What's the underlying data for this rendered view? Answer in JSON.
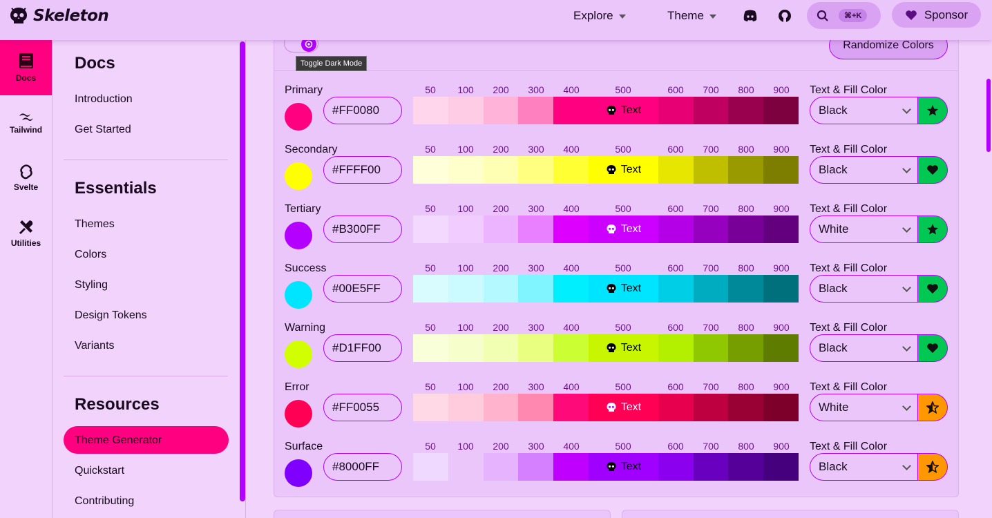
{
  "header": {
    "logo_text": "Skeleton",
    "nav": [
      {
        "label": "Explore"
      },
      {
        "label": "Theme"
      }
    ],
    "search_shortcut": "⌘+K",
    "sponsor_label": "Sponsor"
  },
  "rail": {
    "items": [
      {
        "label": "Docs",
        "icon": "book-icon"
      },
      {
        "label": "Tailwind",
        "icon": "tailwind-icon"
      },
      {
        "label": "Svelte",
        "icon": "svelte-icon"
      },
      {
        "label": "Utilities",
        "icon": "tools-icon"
      }
    ]
  },
  "sidebar": {
    "sections": [
      {
        "title": "Docs",
        "links": [
          "Introduction",
          "Get Started"
        ]
      },
      {
        "title": "Essentials",
        "links": [
          "Themes",
          "Colors",
          "Styling",
          "Design Tokens",
          "Variants"
        ]
      },
      {
        "title": "Resources",
        "links": [
          "Theme Generator",
          "Quickstart",
          "Contributing"
        ]
      }
    ],
    "active_link": "Theme Generator"
  },
  "generator": {
    "tooltip": "Toggle Dark Mode",
    "randomize_label": "Randomize Colors",
    "shade_labels": [
      "50",
      "100",
      "200",
      "300",
      "400",
      "500",
      "600",
      "700",
      "800",
      "900"
    ],
    "text_fill_label": "Text & Fill Color",
    "mid_text": "Text",
    "rows": [
      {
        "name": "Primary",
        "hex": "#FF0080",
        "text_color": "Black",
        "status": "pass",
        "shades": [
          "#ffd6ec",
          "#ffcce6",
          "#ffb3d9",
          "#ff80bf",
          "#ff0080",
          "#ff0080",
          "#e60073",
          "#bf0060",
          "#99004d",
          "#7d003f"
        ]
      },
      {
        "name": "Secondary",
        "hex": "#FFFF00",
        "text_color": "Black",
        "status": "heart",
        "shades": [
          "#ffffd9",
          "#ffffcc",
          "#ffffb3",
          "#ffff80",
          "#ffff33",
          "#ffff00",
          "#e6e600",
          "#bfbf00",
          "#999900",
          "#7d7d00"
        ]
      },
      {
        "name": "Tertiary",
        "hex": "#B300FF",
        "text_color": "White",
        "status": "pass",
        "shades": [
          "#f4d9ff",
          "#f0ccff",
          "#ecb3ff",
          "#e880ff",
          "#dd00ff",
          "#cc00ff",
          "#b300e6",
          "#9600bf",
          "#780099",
          "#62007d"
        ]
      },
      {
        "name": "Success",
        "hex": "#00E5FF",
        "text_color": "Black",
        "status": "heart",
        "shades": [
          "#d9fcff",
          "#ccfbff",
          "#b3f9ff",
          "#80f5ff",
          "#00efff",
          "#00e5ff",
          "#00cee6",
          "#00acbf",
          "#008999",
          "#00707d"
        ]
      },
      {
        "name": "Warning",
        "hex": "#D1FF00",
        "text_color": "Black",
        "status": "heart",
        "shades": [
          "#f8ffd9",
          "#f6ffcc",
          "#f1ffb3",
          "#e8ff80",
          "#ccff33",
          "#c8f500",
          "#b2f000",
          "#8fc700",
          "#779e00",
          "#5e7d00"
        ]
      },
      {
        "name": "Error",
        "hex": "#FF0055",
        "text_color": "White",
        "status": "warn",
        "shades": [
          "#ffd9e6",
          "#ffccdd",
          "#ffb3cc",
          "#ff88b0",
          "#ff0a78",
          "#ff0055",
          "#e6004d",
          "#bf0040",
          "#990033",
          "#7d002a"
        ]
      },
      {
        "name": "Surface",
        "hex": "#8000FF",
        "text_color": "Black",
        "status": "warn",
        "shades": [
          "#f0d9ff",
          "#ebc6fb",
          "#e6b3ff",
          "#d580ff",
          "#c000ff",
          "#a000ff",
          "#8c00f0",
          "#6a00bf",
          "#550099",
          "#44007d"
        ]
      }
    ]
  },
  "colors": {
    "accent": "#b300ff",
    "primary": "#ff0080",
    "pass": "#00c853",
    "warn": "#ff9800"
  }
}
